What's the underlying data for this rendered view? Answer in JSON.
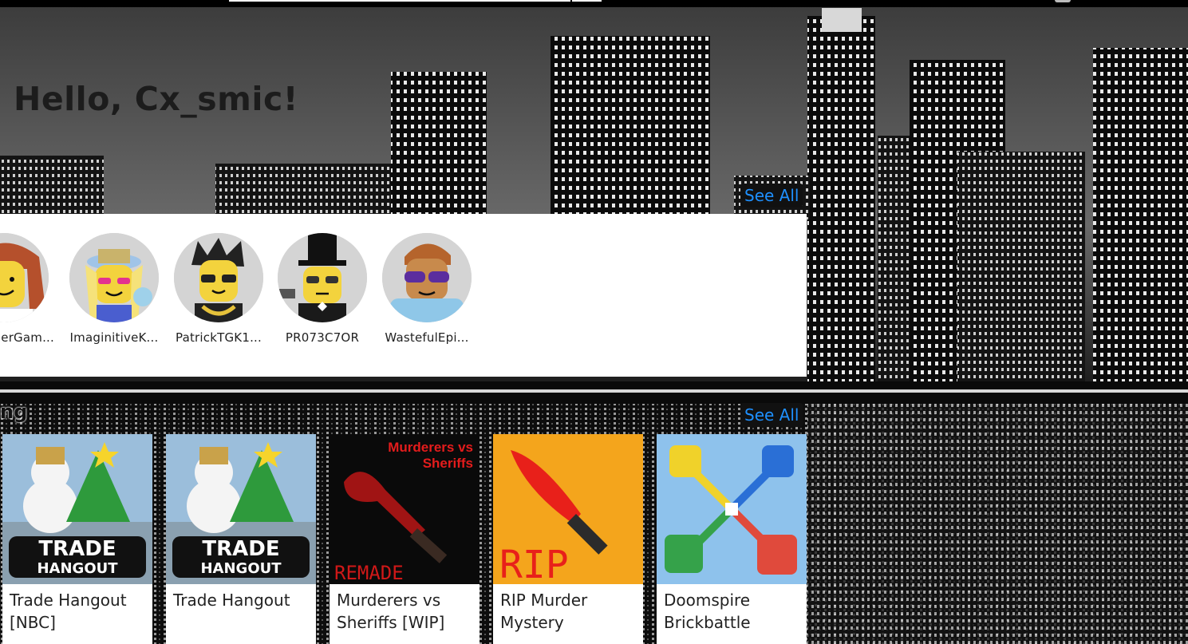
{
  "greeting": "Hello, Cx_smic!",
  "friends_section": {
    "see_all_label": "See All",
    "friends": [
      {
        "name": "erGam..."
      },
      {
        "name": "ImaginitiveK..."
      },
      {
        "name": "PatrickTGK1..."
      },
      {
        "name": "PR073C7OR"
      },
      {
        "name": "WastefulEpi..."
      }
    ]
  },
  "games_section": {
    "title": "ng",
    "see_all_label": "See All",
    "games": [
      {
        "name": "Trade Hangout [NBC]",
        "thumb_text": [
          "TRADE",
          "HANGOUT"
        ]
      },
      {
        "name": "Trade Hangout",
        "thumb_text": [
          "TRADE",
          "HANGOUT"
        ]
      },
      {
        "name": "Murderers vs Sheriffs [WIP]",
        "thumb_text": [
          "Murderers vs",
          "Sheriffs",
          "REMADE"
        ]
      },
      {
        "name": "RIP Murder Mystery",
        "thumb_text": [
          "RIP"
        ]
      },
      {
        "name": "Doomspire Brickbattle",
        "thumb_text": []
      }
    ]
  },
  "colors": {
    "link": "#1e90ff",
    "panel": "#ffffff",
    "topbar": "#000000"
  }
}
